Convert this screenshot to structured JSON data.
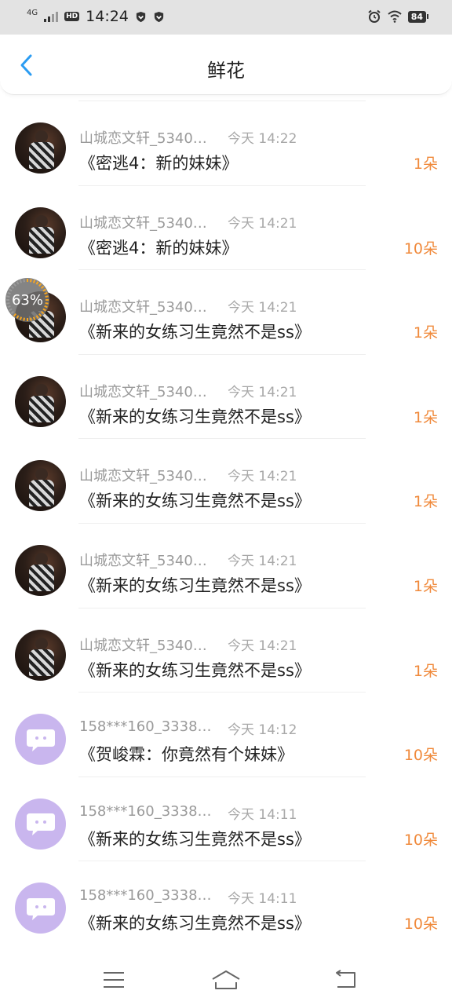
{
  "status_bar": {
    "network": "4G",
    "hd": "HD",
    "time": "14:24",
    "battery": "84",
    "icons": [
      "signal-icon",
      "hd-icon",
      "shield-icon",
      "shield-icon",
      "alarm-icon",
      "wifi-icon",
      "battery-icon"
    ]
  },
  "header": {
    "title": "鲜花",
    "back_icon": "chevron-left-icon"
  },
  "accent_color": "#f08a3c",
  "back_color": "#2b9cf2",
  "progress_badge": {
    "text": "63%",
    "value": 0.63
  },
  "gift_records": [
    {
      "avatar": "photo",
      "username": "山城恋文轩_5340…",
      "time": "今天 14:22",
      "title": "《密逃4：新的妹妹》",
      "count": "1朵"
    },
    {
      "avatar": "photo",
      "username": "山城恋文轩_5340…",
      "time": "今天 14:21",
      "title": "《密逃4：新的妹妹》",
      "count": "10朵"
    },
    {
      "avatar": "photo",
      "username": "山城恋文轩_5340…",
      "time": "今天 14:21",
      "title": "《新来的女练习生竟然不是ss》",
      "count": "1朵"
    },
    {
      "avatar": "photo",
      "username": "山城恋文轩_5340…",
      "time": "今天 14:21",
      "title": "《新来的女练习生竟然不是ss》",
      "count": "1朵"
    },
    {
      "avatar": "photo",
      "username": "山城恋文轩_5340…",
      "time": "今天 14:21",
      "title": "《新来的女练习生竟然不是ss》",
      "count": "1朵"
    },
    {
      "avatar": "photo",
      "username": "山城恋文轩_5340…",
      "time": "今天 14:21",
      "title": "《新来的女练习生竟然不是ss》",
      "count": "1朵"
    },
    {
      "avatar": "photo",
      "username": "山城恋文轩_5340…",
      "time": "今天 14:21",
      "title": "《新来的女练习生竟然不是ss》",
      "count": "1朵"
    },
    {
      "avatar": "default-bubble",
      "username": "158***160_3338…",
      "time": "今天 14:12",
      "title": "《贺峻霖：你竟然有个妹妹》",
      "count": "10朵"
    },
    {
      "avatar": "default-bubble",
      "username": "158***160_3338…",
      "time": "今天 14:11",
      "title": "《新来的女练习生竟然不是ss》",
      "count": "10朵"
    },
    {
      "avatar": "default-bubble",
      "username": "158***160_3338…",
      "time": "今天 14:11",
      "title": "《新来的女练习生竟然不是ss》",
      "count": "10朵"
    }
  ],
  "nav_bar": {
    "icons": [
      "menu-icon",
      "home-icon",
      "back-icon"
    ]
  }
}
